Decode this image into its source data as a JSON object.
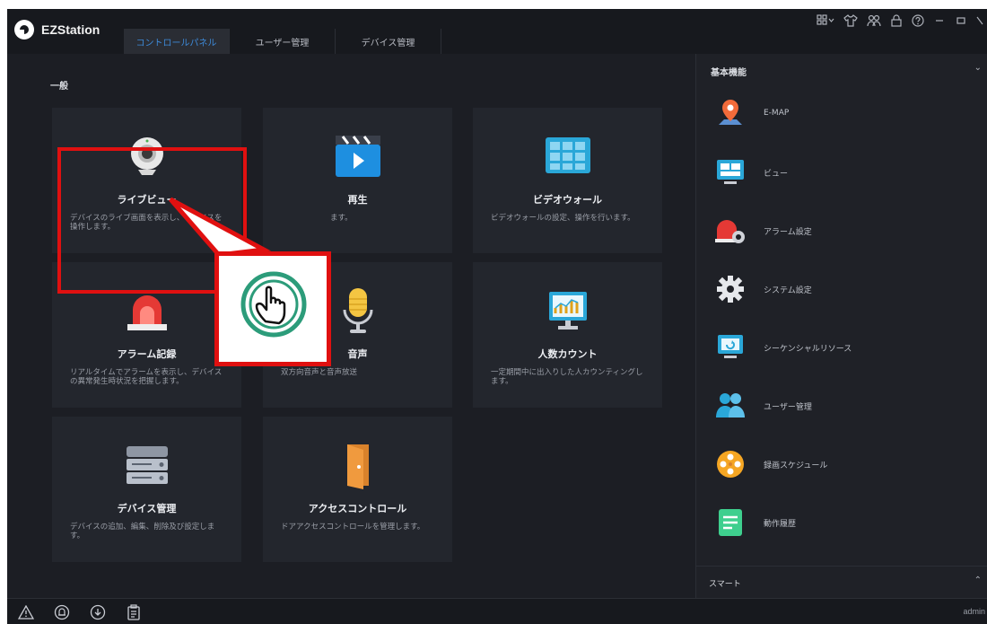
{
  "app": {
    "title": "EZStation"
  },
  "tabs": [
    {
      "label": "コントロールパネル",
      "active": true
    },
    {
      "label": "ユーザー管理",
      "active": false
    },
    {
      "label": "デバイス管理",
      "active": false
    }
  ],
  "window_controls": [
    "grid-icon",
    "shirt-icon",
    "users-icon",
    "lock-icon",
    "help-icon",
    "minimize-icon",
    "maximize-icon",
    "close-icon"
  ],
  "main": {
    "section_title": "一般",
    "cards": [
      {
        "title": "ライブビュー",
        "desc": "デバイスのライブ画面を表示し、デバイスを操作します。",
        "icon": "camera-icon"
      },
      {
        "title": "再生",
        "desc": "ます。",
        "icon": "video-play-icon"
      },
      {
        "title": "ビデオウォール",
        "desc": "ビデオウォールの設定、操作を行います。",
        "icon": "video-wall-icon"
      },
      {
        "title": "アラーム記録",
        "desc": "リアルタイムでアラームを表示し、デバイスの異常発生時状況を把握します。",
        "icon": "alarm-light-icon"
      },
      {
        "title": "音声",
        "desc": "双方向音声と音声放送",
        "icon": "microphone-icon"
      },
      {
        "title": "人数カウント",
        "desc": "一定期間中に出入りした人カウンティングします。",
        "icon": "counting-chart-icon"
      },
      {
        "title": "デバイス管理",
        "desc": "デバイスの追加、編集、削除及び設定します。",
        "icon": "server-icon"
      },
      {
        "title": "アクセスコントロール",
        "desc": "ドアアクセスコントロールを管理します。",
        "icon": "door-icon"
      }
    ]
  },
  "sidebar": {
    "header": "基本機能",
    "items": [
      {
        "label": "E-MAP",
        "icon": "map-pin-icon"
      },
      {
        "label": "ビュー",
        "icon": "monitor-view-icon"
      },
      {
        "label": "アラーム設定",
        "icon": "alarm-settings-icon"
      },
      {
        "label": "システム設定",
        "icon": "gear-icon"
      },
      {
        "label": "シーケンシャルリソース",
        "icon": "sequence-monitor-icon"
      },
      {
        "label": "ユーザー管理",
        "icon": "users-icon"
      },
      {
        "label": "録画スケジュール",
        "icon": "film-reel-icon"
      },
      {
        "label": "動作履歴",
        "icon": "log-document-icon"
      }
    ],
    "footer": "スマート"
  },
  "status": {
    "user": "admin"
  },
  "colors": {
    "accent": "#3d8ad9",
    "highlight": "#e01010",
    "panel": "#23262d",
    "bg": "#1c1e24"
  }
}
